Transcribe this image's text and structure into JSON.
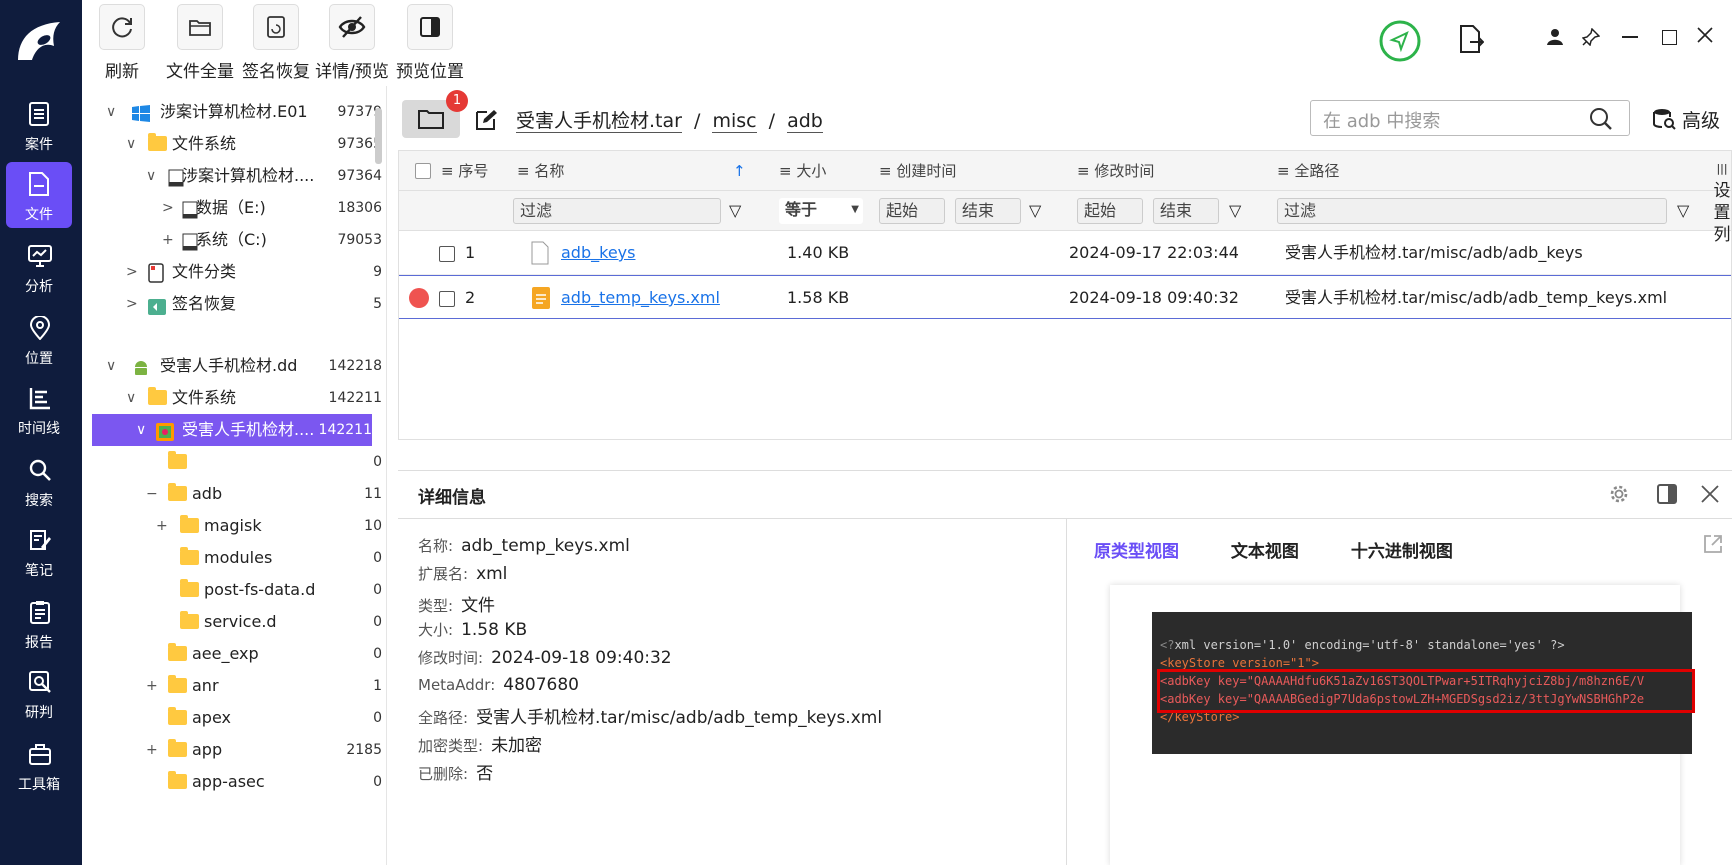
{
  "toolbar": {
    "refresh": "刷新",
    "file_all": "文件全量",
    "sig_recover": "签名恢复",
    "detail_preview": "详情/预览",
    "preview_pos": "预览位置"
  },
  "nav": {
    "items": [
      "案件",
      "文件",
      "分析",
      "位置",
      "时间线",
      "搜索",
      "笔记",
      "报告",
      "研判",
      "工具箱"
    ],
    "active": "文件"
  },
  "tree": {
    "rows": [
      {
        "label": "涉案计算机检材.E01",
        "count": "97379",
        "toggle": "∨"
      },
      {
        "label": "文件系统",
        "count": "97365",
        "toggle": "∨"
      },
      {
        "label": "涉案计算机检材....",
        "count": "97364",
        "toggle": "∨"
      },
      {
        "label": "数据（E:)",
        "count": "18306",
        "toggle": ">"
      },
      {
        "label": "系统（C:)",
        "count": "79053",
        "toggle": "+"
      },
      {
        "label": "文件分类",
        "count": "9",
        "toggle": ">"
      },
      {
        "label": "签名恢复",
        "count": "5",
        "toggle": ">"
      },
      {
        "label": "受害人手机检材.dd",
        "count": "142218",
        "toggle": "∨"
      },
      {
        "label": "文件系统",
        "count": "142211",
        "toggle": "∨"
      },
      {
        "label": "受害人手机检材....",
        "count": "142211",
        "toggle": "∨"
      },
      {
        "label": "",
        "count": "0",
        "toggle": ""
      },
      {
        "label": "adb",
        "count": "11",
        "toggle": "−"
      },
      {
        "label": "magisk",
        "count": "10",
        "toggle": "+"
      },
      {
        "label": "modules",
        "count": "0",
        "toggle": ""
      },
      {
        "label": "post-fs-data.d",
        "count": "0",
        "toggle": ""
      },
      {
        "label": "service.d",
        "count": "0",
        "toggle": ""
      },
      {
        "label": "aee_exp",
        "count": "0",
        "toggle": ""
      },
      {
        "label": "anr",
        "count": "1",
        "toggle": "+"
      },
      {
        "label": "apex",
        "count": "0",
        "toggle": ""
      },
      {
        "label": "app",
        "count": "2185",
        "toggle": "+"
      },
      {
        "label": "app-asec",
        "count": "0",
        "toggle": ""
      }
    ]
  },
  "path": {
    "badge": "1",
    "segments": [
      "受害人手机检材.tar",
      "misc",
      "adb"
    ],
    "sep": "/",
    "search_placeholder": "在 adb 中搜索",
    "advanced": "高级"
  },
  "grid": {
    "headers": [
      "序号",
      "名称",
      "大小",
      "创建时间",
      "修改时间",
      "全路径"
    ],
    "filter_placeholder": "过滤",
    "size_op": "等于",
    "start": "起始",
    "end": "结束",
    "rows": [
      {
        "idx": "1",
        "name": "adb_keys",
        "size": "1.40 KB",
        "created": "",
        "modified": "2024-09-17 22:03:44",
        "path": "受害人手机检材.tar/misc/adb/adb_keys"
      },
      {
        "idx": "2",
        "name": "adb_temp_keys.xml",
        "size": "1.58 KB",
        "created": "",
        "modified": "2024-09-18 09:40:32",
        "path": "受害人手机检材.tar/misc/adb/adb_temp_keys.xml"
      }
    ],
    "side_label": "设置列"
  },
  "detail": {
    "title": "详细信息",
    "fields": [
      {
        "k": "名称:",
        "v": "adb_temp_keys.xml"
      },
      {
        "k": "扩展名:",
        "v": "xml"
      },
      {
        "k": "类型:",
        "v": "文件"
      },
      {
        "k": "大小:",
        "v": "1.58 KB"
      },
      {
        "k": "修改时间:",
        "v": "2024-09-18 09:40:32"
      },
      {
        "k": "MetaAddr:",
        "v": "4807680"
      },
      {
        "k": "全路径:",
        "v": "受害人手机检材.tar/misc/adb/adb_temp_keys.xml"
      },
      {
        "k": "加密类型:",
        "v": "未加密"
      },
      {
        "k": "已删除:",
        "v": "否"
      }
    ],
    "tabs": [
      "原类型视图",
      "文本视图",
      "十六进制视图"
    ],
    "active_tab": "原类型视图",
    "code_lines": [
      "<?xml version='1.0' encoding='utf-8' standalone='yes' ?>",
      "<keyStore version=\"1\">",
      "<adbKey key=\"QAAAAHdfu6K51aZv16ST3QOLTPwar+5ITRqhyjciZ8bj/m8hzn6E/V",
      "<adbKey key=\"QAAAABGedigP7Uda6pstowLZH+MGEDSgsd2iz/3ttJgYwNSBHGhP2e",
      "</keyStore>"
    ]
  },
  "colors": {
    "nav_bg": "#0f1c3d",
    "accent": "#7b57f0",
    "link": "#1a73e8",
    "highlight_box": "#e00000"
  }
}
